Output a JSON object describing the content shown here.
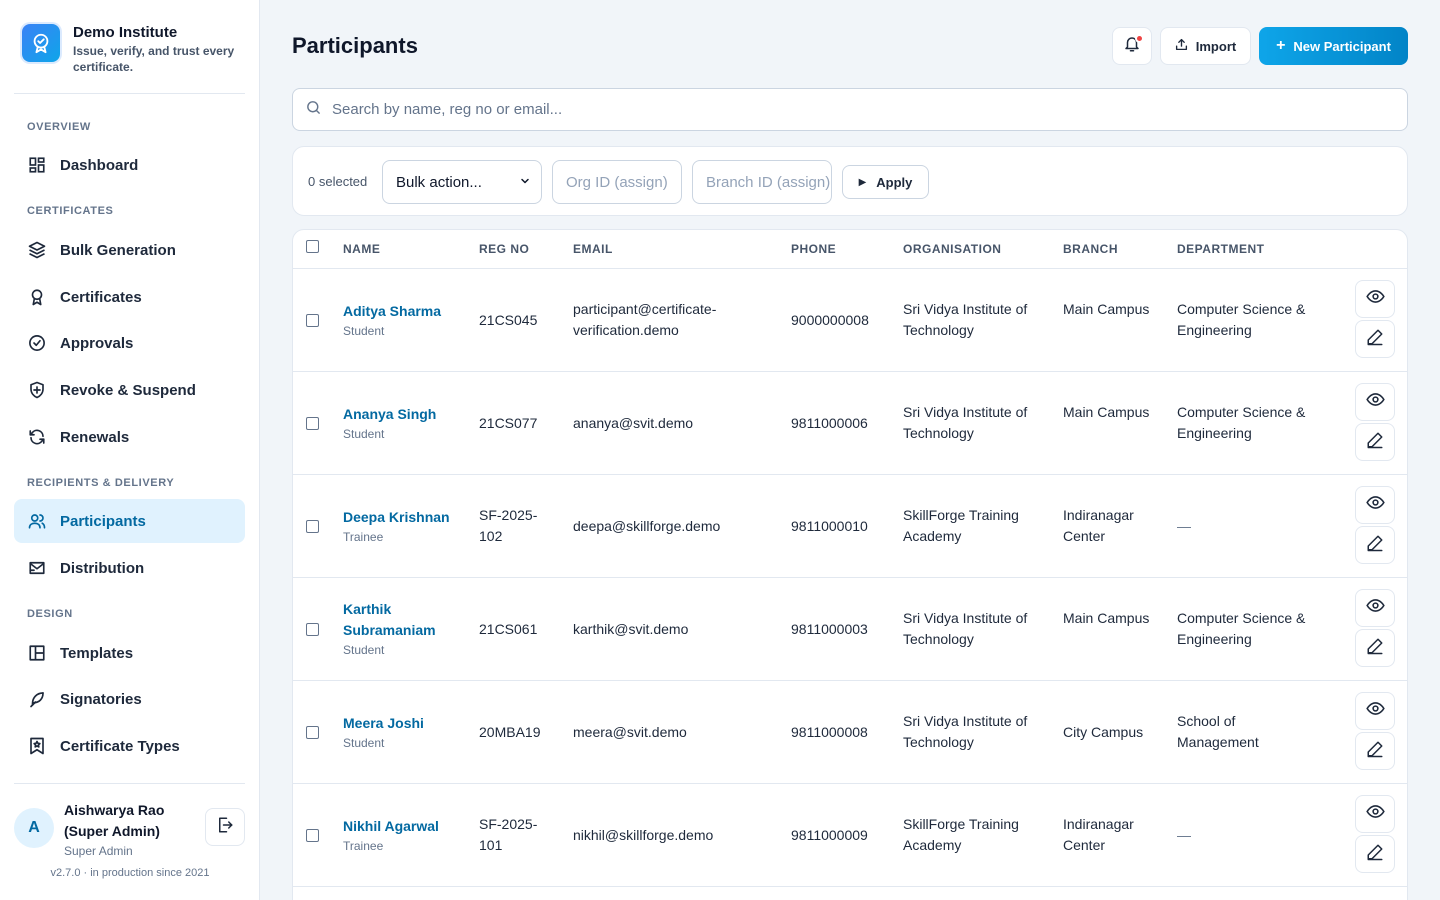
{
  "brand": {
    "name": "Demo Institute",
    "tagline": "Issue, verify, and trust every certificate."
  },
  "sidebar": {
    "sections": [
      {
        "title": "OVERVIEW",
        "items": [
          {
            "label": "Dashboard",
            "icon": "dashboard-icon"
          }
        ]
      },
      {
        "title": "CERTIFICATES",
        "items": [
          {
            "label": "Bulk Generation",
            "icon": "layers-icon"
          },
          {
            "label": "Certificates",
            "icon": "award-icon"
          },
          {
            "label": "Approvals",
            "icon": "check-circle-icon"
          },
          {
            "label": "Revoke & Suspend",
            "icon": "shield-icon"
          },
          {
            "label": "Renewals",
            "icon": "refresh-icon"
          }
        ]
      },
      {
        "title": "RECIPIENTS & DELIVERY",
        "items": [
          {
            "label": "Participants",
            "icon": "users-icon",
            "active": true
          },
          {
            "label": "Distribution",
            "icon": "send-icon"
          }
        ]
      },
      {
        "title": "DESIGN",
        "items": [
          {
            "label": "Templates",
            "icon": "layout-icon"
          },
          {
            "label": "Signatories",
            "icon": "feather-icon"
          },
          {
            "label": "Certificate Types",
            "icon": "bookmark-icon"
          }
        ]
      }
    ]
  },
  "user": {
    "initial": "A",
    "name": "Aishwarya Rao (Super Admin)",
    "role": "Super Admin"
  },
  "version": "v2.7.0 · in production since 2021",
  "header": {
    "title": "Participants",
    "import_label": "Import",
    "new_label": "New Participant"
  },
  "search": {
    "placeholder": "Search by name, reg no or email..."
  },
  "bulk": {
    "selected": "0 selected",
    "action_value": "Bulk action...",
    "org_placeholder": "Org ID (assign)",
    "branch_placeholder": "Branch ID (assign)",
    "apply_label": "Apply"
  },
  "table": {
    "columns": [
      "NAME",
      "REG NO",
      "EMAIL",
      "PHONE",
      "ORGANISATION",
      "BRANCH",
      "DEPARTMENT"
    ],
    "rows": [
      {
        "name": "Aditya Sharma",
        "type": "Student",
        "reg": "21CS045",
        "email": "participant@certificate-verification.demo",
        "phone": "9000000008",
        "org": "Sri Vidya Institute of Technology",
        "branch": "Main Campus",
        "dept": "Computer Science & Engineering"
      },
      {
        "name": "Ananya Singh",
        "type": "Student",
        "reg": "21CS077",
        "email": "ananya@svit.demo",
        "phone": "9811000006",
        "org": "Sri Vidya Institute of Technology",
        "branch": "Main Campus",
        "dept": "Computer Science & Engineering"
      },
      {
        "name": "Deepa Krishnan",
        "type": "Trainee",
        "reg": "SF-2025-102",
        "email": "deepa@skillforge.demo",
        "phone": "9811000010",
        "org": "SkillForge Training Academy",
        "branch": "Indiranagar Center",
        "dept": "—"
      },
      {
        "name": "Karthik Subramaniam",
        "type": "Student",
        "reg": "21CS061",
        "email": "karthik@svit.demo",
        "phone": "9811000003",
        "org": "Sri Vidya Institute of Technology",
        "branch": "Main Campus",
        "dept": "Computer Science & Engineering"
      },
      {
        "name": "Meera Joshi",
        "type": "Student",
        "reg": "20MBA19",
        "email": "meera@svit.demo",
        "phone": "9811000008",
        "org": "Sri Vidya Institute of Technology",
        "branch": "City Campus",
        "dept": "School of Management"
      },
      {
        "name": "Nikhil Agarwal",
        "type": "Trainee",
        "reg": "SF-2025-101",
        "email": "nikhil@skillforge.demo",
        "phone": "9811000009",
        "org": "SkillForge Training Academy",
        "branch": "Indiranagar Center",
        "dept": "—"
      }
    ]
  },
  "colors": {
    "accent": "#0284c7",
    "link": "#0369a1",
    "active_bg": "#e0f2fe",
    "notification": "#ef4444"
  }
}
